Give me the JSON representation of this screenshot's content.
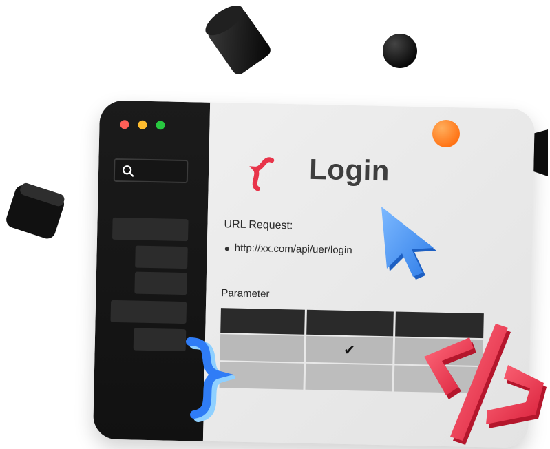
{
  "window": {
    "controls": [
      "close",
      "minimize",
      "maximize"
    ],
    "colors": {
      "close": "#ff5f57",
      "minimize": "#febc2e",
      "maximize": "#28c840"
    }
  },
  "sidebar": {
    "search_icon": "search-icon",
    "items": [
      "",
      "",
      "",
      "",
      ""
    ]
  },
  "page": {
    "title": "Login",
    "url_label": "URL Request:",
    "url": "http://xx.com/api/uer/login",
    "parameter_label": "Parameter"
  },
  "table": {
    "header": [
      "",
      "",
      ""
    ],
    "rows": [
      [
        "",
        "✔",
        ""
      ],
      [
        "",
        "",
        ""
      ]
    ]
  },
  "decorations": {
    "icons": [
      "curly-brace-icon-red",
      "curly-brace-icon-blue",
      "cursor-icon",
      "code-slash-icon",
      "orange-ball",
      "black-cylinder",
      "black-sphere",
      "black-cube",
      "black-cone"
    ],
    "accent": "#e8344a",
    "blue": "#3b8cf5",
    "orange": "#ff7a1a"
  }
}
